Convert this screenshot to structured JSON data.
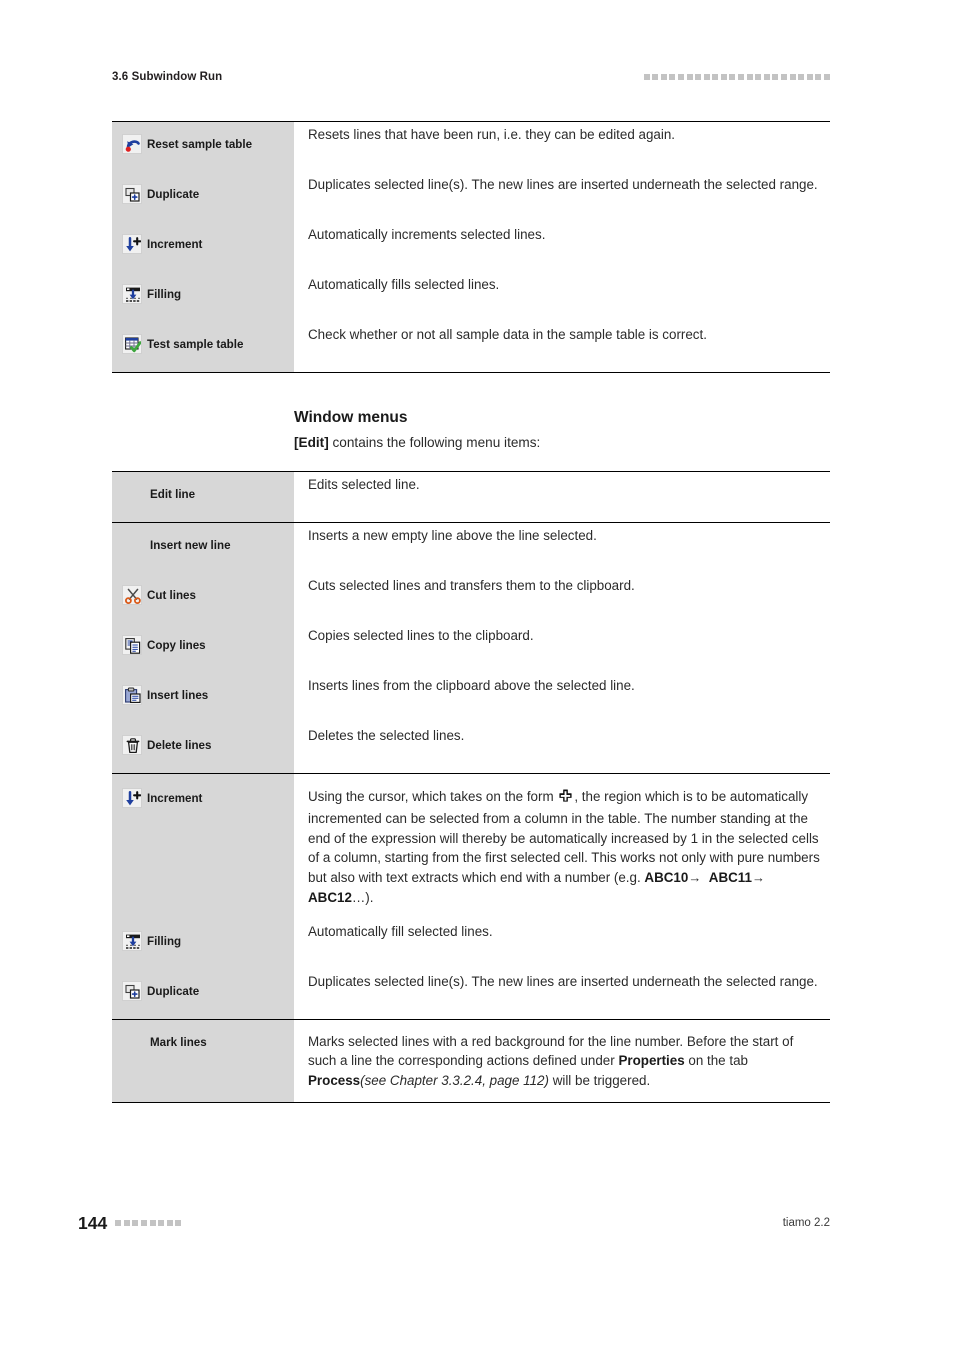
{
  "header": {
    "title": "3.6 Subwindow Run",
    "marker_squares": 22
  },
  "table_toolbar": {
    "rows": [
      {
        "icon": "reset-arrow-icon",
        "label": "Reset sample table",
        "description": "Resets lines that have been run, i.e. they can be edited again."
      },
      {
        "icon": "duplicate-icon",
        "label": "Duplicate",
        "description": "Duplicates selected line(s). The new lines are inserted underneath the selected range."
      },
      {
        "icon": "increment-icon",
        "label": "Increment",
        "description": "Automatically increments selected lines."
      },
      {
        "icon": "filling-icon",
        "label": "Filling",
        "description": "Automatically fills selected lines."
      },
      {
        "icon": "test-sample-table-icon",
        "label": "Test sample table",
        "description": "Check whether or not all sample data in the sample table is correct."
      }
    ]
  },
  "section": {
    "heading": "Window menus",
    "intro_bold": "[Edit]",
    "intro_rest": " contains the following menu items:"
  },
  "table_edit_menu": {
    "rows": [
      {
        "icon": null,
        "label": "Edit line",
        "description": "Edits selected line."
      },
      {
        "icon": null,
        "label": "Insert new line",
        "description": "Inserts a new empty line above the line selected."
      },
      {
        "icon": "scissors-icon",
        "label": "Cut lines",
        "description": "Cuts selected lines and transfers them to the clipboard."
      },
      {
        "icon": "copy-icon",
        "label": "Copy lines",
        "description": "Copies selected lines to the clipboard."
      },
      {
        "icon": "paste-icon",
        "label": "Insert lines",
        "description": "Inserts lines from the clipboard above the selected line."
      },
      {
        "icon": "trash-icon",
        "label": "Delete lines",
        "description": "Deletes the selected lines."
      }
    ],
    "increment_row": {
      "icon": "increment-icon",
      "label": "Increment",
      "text_part1": "Using the cursor, which takes on the form ",
      "cursor_icon": "crosshair-cursor-icon",
      "text_part2": ", the region which is to be automatically incremented can be selected from a column in the table. The number standing at the end of the expression will thereby be automatically increased by 1 in the selected cells of a column, starting from the first selected cell. This works not only with pure numbers but also with text extracts which end with a number (e.g. ",
      "example_1": "ABC10",
      "example_arrow_1": "→",
      "example_2": "ABC11",
      "example_arrow_2": "→",
      "example_3": "ABC12",
      "text_part3": "…)."
    },
    "filling_row": {
      "icon": "filling-icon",
      "label": "Filling",
      "description": "Automatically fill selected lines."
    },
    "duplicate_row": {
      "icon": "duplicate-icon",
      "label": "Duplicate",
      "description": "Duplicates selected line(s). The new lines are inserted underneath the selected range."
    },
    "mark_row": {
      "icon": null,
      "label": "Mark lines",
      "text_part1": "Marks selected lines with a red background for the line number. Before the start of such a line the corresponding actions defined under ",
      "bold_1": "Properties",
      "text_part2": " on the tab ",
      "bold_2": "Process",
      "italic_ref": "(see Chapter 3.3.2.4, page 112)",
      "text_part3": " will be triggered."
    }
  },
  "footer": {
    "page_number": "144",
    "marker_squares": 8,
    "product": "tiamo 2.2"
  },
  "colors": {
    "label_column_bg": "#d7d7d7",
    "rule": "#000000",
    "marker_square": "#c3c3c3",
    "icon_blue": "#1f3f9e",
    "icon_red": "#e02020",
    "icon_green": "#3ea63e",
    "icon_orange": "#d95a1a"
  }
}
